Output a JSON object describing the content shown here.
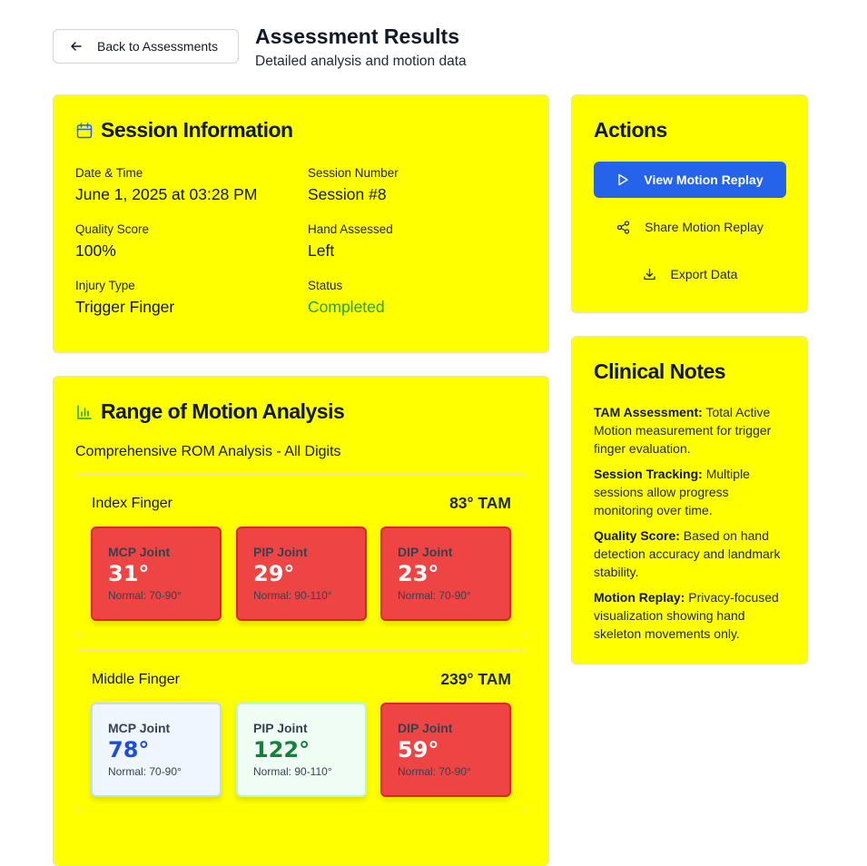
{
  "header": {
    "back_label": "Back to Assessments",
    "title": "Assessment Results",
    "subtitle": "Detailed analysis and motion data"
  },
  "session": {
    "title": "Session Information",
    "fields": [
      {
        "label": "Date & Time",
        "value": "June 1, 2025 at 03:28 PM"
      },
      {
        "label": "Session Number",
        "value": "Session #8"
      },
      {
        "label": "Quality Score",
        "value": "100%"
      },
      {
        "label": "Hand Assessed",
        "value": "Left"
      },
      {
        "label": "Injury Type",
        "value": "Trigger Finger"
      },
      {
        "label": "Status",
        "value": "Completed"
      }
    ]
  },
  "rom": {
    "title": "Range of Motion Analysis",
    "subtitle": "Comprehensive ROM Analysis - All Digits",
    "fingers": [
      {
        "name": "Index Finger",
        "tam": "83° TAM",
        "joints": [
          {
            "name": "MCP Joint",
            "value": "31°",
            "normal": "Normal: 70-90°",
            "status": "bad"
          },
          {
            "name": "PIP Joint",
            "value": "29°",
            "normal": "Normal: 90-110°",
            "status": "bad"
          },
          {
            "name": "DIP Joint",
            "value": "23°",
            "normal": "Normal: 70-90°",
            "status": "bad"
          }
        ]
      },
      {
        "name": "Middle Finger",
        "tam": "239° TAM",
        "joints": [
          {
            "name": "MCP Joint",
            "value": "78°",
            "normal": "Normal: 70-90°",
            "status": "okblue"
          },
          {
            "name": "PIP Joint",
            "value": "122°",
            "normal": "Normal: 90-110°",
            "status": "good"
          },
          {
            "name": "DIP Joint",
            "value": "59°",
            "normal": "Normal: 70-90°",
            "status": "bad"
          }
        ]
      }
    ]
  },
  "actions": {
    "title": "Actions",
    "view_replay": "View Motion Replay",
    "share_replay": "Share Motion Replay",
    "export": "Export Data"
  },
  "notes": {
    "title": "Clinical Notes",
    "items": [
      {
        "label": "TAM Assessment:",
        "text": " Total Active Motion measurement for trigger finger evaluation."
      },
      {
        "label": "Session Tracking:",
        "text": " Multiple sessions allow progress monitoring over time."
      },
      {
        "label": "Quality Score:",
        "text": " Based on hand detection accuracy and landmark stability."
      },
      {
        "label": "Motion Replay:",
        "text": " Privacy-focused visualization showing hand skeleton movements only."
      }
    ]
  },
  "colors": {
    "card_bg": "#ffff00",
    "primary": "#2563eb",
    "bad": "#ef4444",
    "status_complete": "#16a34a"
  }
}
